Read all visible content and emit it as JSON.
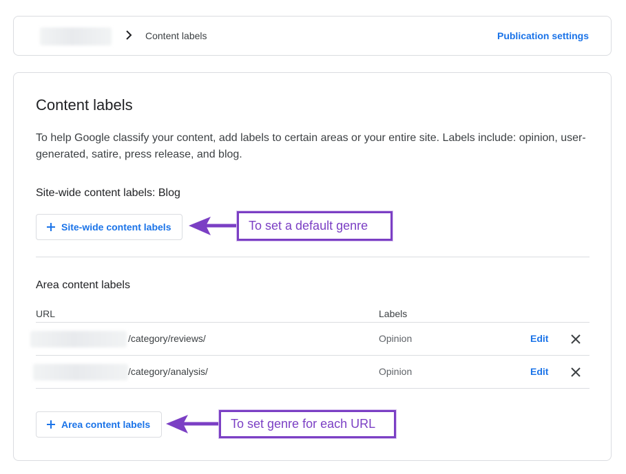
{
  "breadcrumb": {
    "current": "Content labels"
  },
  "header": {
    "publication_settings": "Publication settings"
  },
  "page": {
    "title": "Content labels",
    "description": "To help Google classify your content, add labels to certain areas or your entire site. Labels include: opinion, user-generated, satire, press release, and blog."
  },
  "sitewide": {
    "heading": "Site-wide content labels: Blog",
    "button_label": "Site-wide content labels"
  },
  "area": {
    "heading": "Area content labels",
    "columns": {
      "url": "URL",
      "labels": "Labels"
    },
    "rows": [
      {
        "url": "/category/reviews/",
        "label": "Opinion",
        "edit": "Edit"
      },
      {
        "url": "/category/analysis/",
        "label": "Opinion",
        "edit": "Edit"
      }
    ],
    "button_label": "Area content labels"
  },
  "annotations": {
    "default_genre": "To set a default genre",
    "each_url": "To set genre for each URL"
  },
  "colors": {
    "accent": "#1a73e8",
    "annotation": "#7b3fc4",
    "border": "#dadce0"
  }
}
